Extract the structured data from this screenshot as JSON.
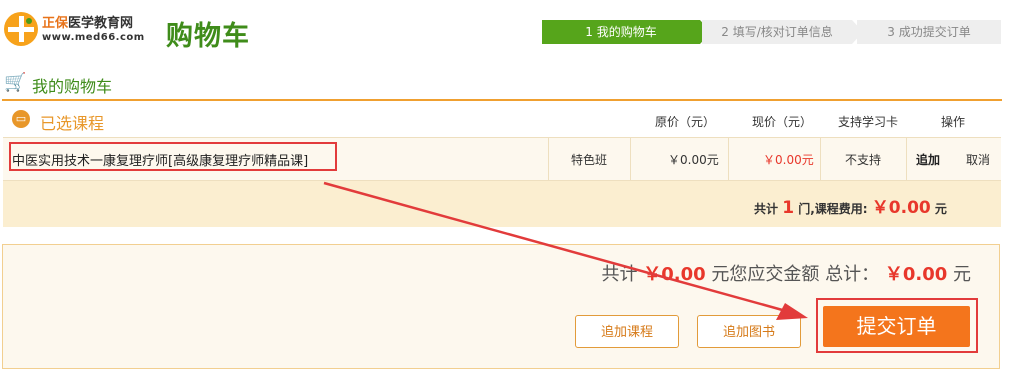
{
  "header": {
    "logo_brand_a": "正保",
    "logo_brand_b": "医学教育网",
    "logo_url": "www.med66.com",
    "page_title": "购物车"
  },
  "steps": [
    {
      "label": "1  我的购物车",
      "active": true
    },
    {
      "label": "2  填写/核对订单信息",
      "active": false
    },
    {
      "label": "3  成功提交订单",
      "active": false
    }
  ],
  "section": {
    "title": "我的购物车"
  },
  "cart": {
    "selected_title": "已选课程",
    "columns": {
      "original_price": "原价（元）",
      "current_price": "现价（元）",
      "study_card": "支持学习卡",
      "actions": "操作"
    },
    "items": [
      {
        "name": "中医实用技术一康复理疗师[高级康复理疗师精品课]",
        "type": "特色班",
        "original_price": "￥0.00元",
        "current_price": "￥0.00元",
        "study_card": "不支持",
        "add_label": "追加",
        "cancel_label": "取消"
      }
    ],
    "summary": {
      "prefix": "共计",
      "count": "1",
      "middle": "门,课程费用:",
      "fee": "￥0.00",
      "unit": "元"
    }
  },
  "order": {
    "total_prefix": "共计",
    "total_amount": "￥0.00",
    "total_middle": "元您应交金额 总计：",
    "payable_amount": "￥0.00",
    "total_unit": "元",
    "add_course_label": "追加课程",
    "add_book_label": "追加图书",
    "submit_label": "提交订单"
  },
  "colors": {
    "brand_green": "#3f8c1a",
    "accent_orange": "#f4751c",
    "price_red": "#e8372b",
    "annotation_red": "#e23b3b"
  }
}
